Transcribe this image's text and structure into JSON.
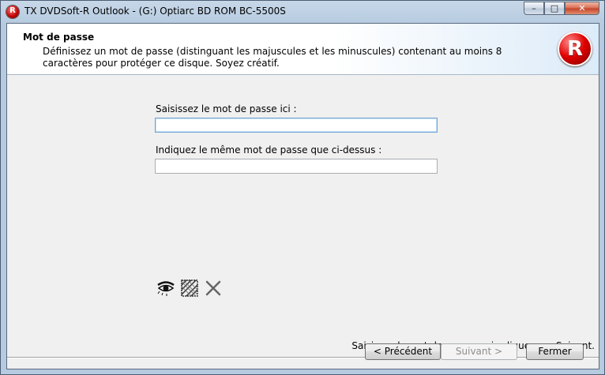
{
  "window": {
    "title": "TX DVDSoft-R Outlook - (G:) Optiarc BD ROM BC-5500S",
    "app_icon_letter": "R",
    "controls": {
      "minimize": "–",
      "maximize": "□",
      "close": "✕"
    }
  },
  "header": {
    "title": "Mot de passe",
    "description": "Définissez un mot de passe (distinguant les majuscules et les minuscules) contenant au moins 8 caractères pour protéger ce disque. Soyez créatif.",
    "logo_letter": "R"
  },
  "form": {
    "password_label": "Saisissez le mot de passe ici :",
    "password_value": "",
    "confirm_label": "Indiquez le même mot de passe que ci-dessus :",
    "confirm_value": ""
  },
  "tools": [
    {
      "icon": "eye-icon"
    },
    {
      "icon": "pattern-icon"
    },
    {
      "icon": "clear-icon"
    }
  ],
  "footer": {
    "hint": "Saisissez le mot de passe, puis cliquez sur Suivant."
  },
  "buttons": {
    "previous": "< Précédent",
    "next": "Suivant >",
    "close": "Fermer"
  },
  "colors": {
    "title_bar": "#b6cbe0",
    "brand_red": "#e00000",
    "focus_border": "#6fa6d6"
  }
}
